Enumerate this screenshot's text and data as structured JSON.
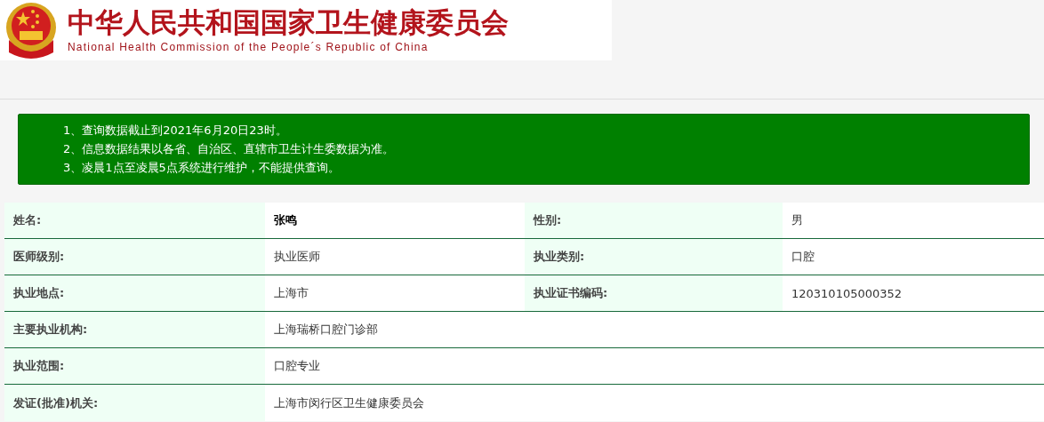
{
  "header": {
    "title": "中华人民共和国国家卫生健康委员会",
    "subtitle": "National Health Commission of the People´s Republic of China"
  },
  "notice": [
    "1、查询数据截止到2021年6月20日23时。",
    "2、信息数据结果以各省、自治区、直辖市卫生计生委数据为准。",
    "3、凌晨1点至凌晨5点系统进行维护，不能提供查询。"
  ],
  "rows": [
    {
      "fields": [
        {
          "label": "姓名:",
          "value": "张鸣",
          "bold": true
        },
        {
          "label": "性别:",
          "value": "男",
          "bold": false
        }
      ]
    },
    {
      "fields": [
        {
          "label": "医师级别:",
          "value": "执业医师",
          "bold": false
        },
        {
          "label": "执业类别:",
          "value": "口腔",
          "bold": false
        }
      ]
    },
    {
      "fields": [
        {
          "label": "执业地点:",
          "value": "上海市",
          "bold": false
        },
        {
          "label": "执业证书编码:",
          "value": "120310105000352",
          "bold": false
        }
      ]
    },
    {
      "fields": [
        {
          "label": "主要执业机构:",
          "value": "上海瑞桥口腔门诊部",
          "bold": false
        }
      ]
    },
    {
      "fields": [
        {
          "label": "执业范围:",
          "value": "口腔专业",
          "bold": false
        }
      ]
    },
    {
      "fields": [
        {
          "label": "发证(批准)机关:",
          "value": "上海市闵行区卫生健康委员会",
          "bold": false
        }
      ]
    }
  ]
}
